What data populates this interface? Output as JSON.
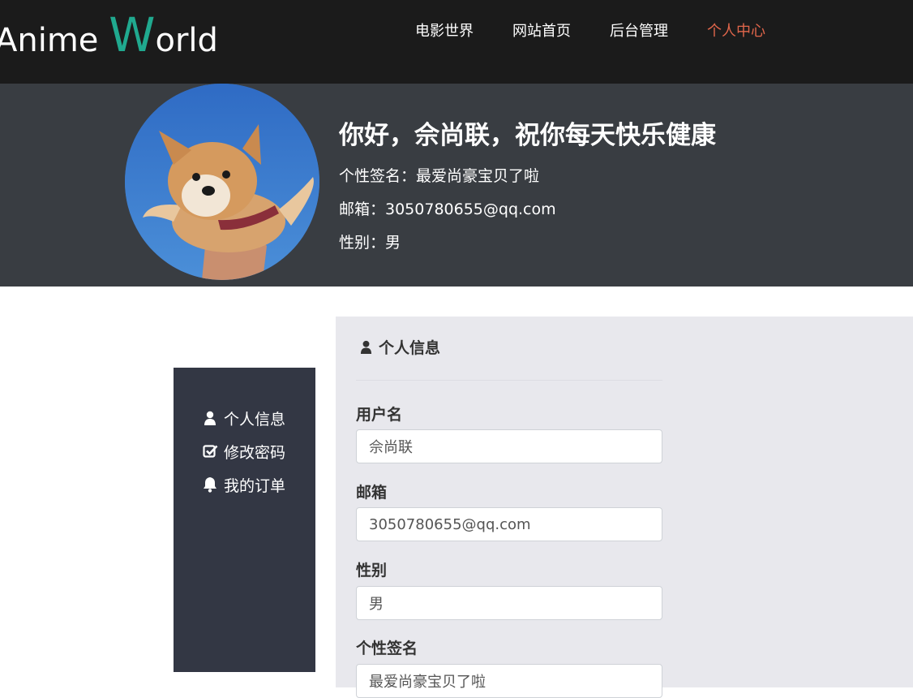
{
  "logo": {
    "prefix": "Anime ",
    "initial": "W",
    "suffix": "orld"
  },
  "nav": [
    {
      "label": "电影世界"
    },
    {
      "label": "网站首页"
    },
    {
      "label": "后台管理"
    },
    {
      "label": "个人中心",
      "active": true
    }
  ],
  "banner": {
    "greeting": "你好，佘尚联，祝你每天快乐健康",
    "signature": "个性签名：最爱尚豪宝贝了啦",
    "email": "邮箱：3050780655@qq.com",
    "gender": "性别：男"
  },
  "sidebar": {
    "items": [
      {
        "label": "个人信息",
        "icon": "user-icon"
      },
      {
        "label": "修改密码",
        "icon": "check-square-icon"
      },
      {
        "label": "我的订单",
        "icon": "bell-icon"
      }
    ]
  },
  "panel": {
    "title": "个人信息",
    "fields": [
      {
        "label": "用户名",
        "value": "佘尚联"
      },
      {
        "label": "邮箱",
        "value": "3050780655@qq.com"
      },
      {
        "label": "性别",
        "value": "男"
      },
      {
        "label": "个性签名",
        "value": "最爱尚豪宝贝了啦"
      }
    ]
  },
  "colors": {
    "accent": "#20a98f",
    "active_nav": "#e0664b",
    "sidebar_bg": "#333744",
    "banner_bg": "#393d42"
  }
}
